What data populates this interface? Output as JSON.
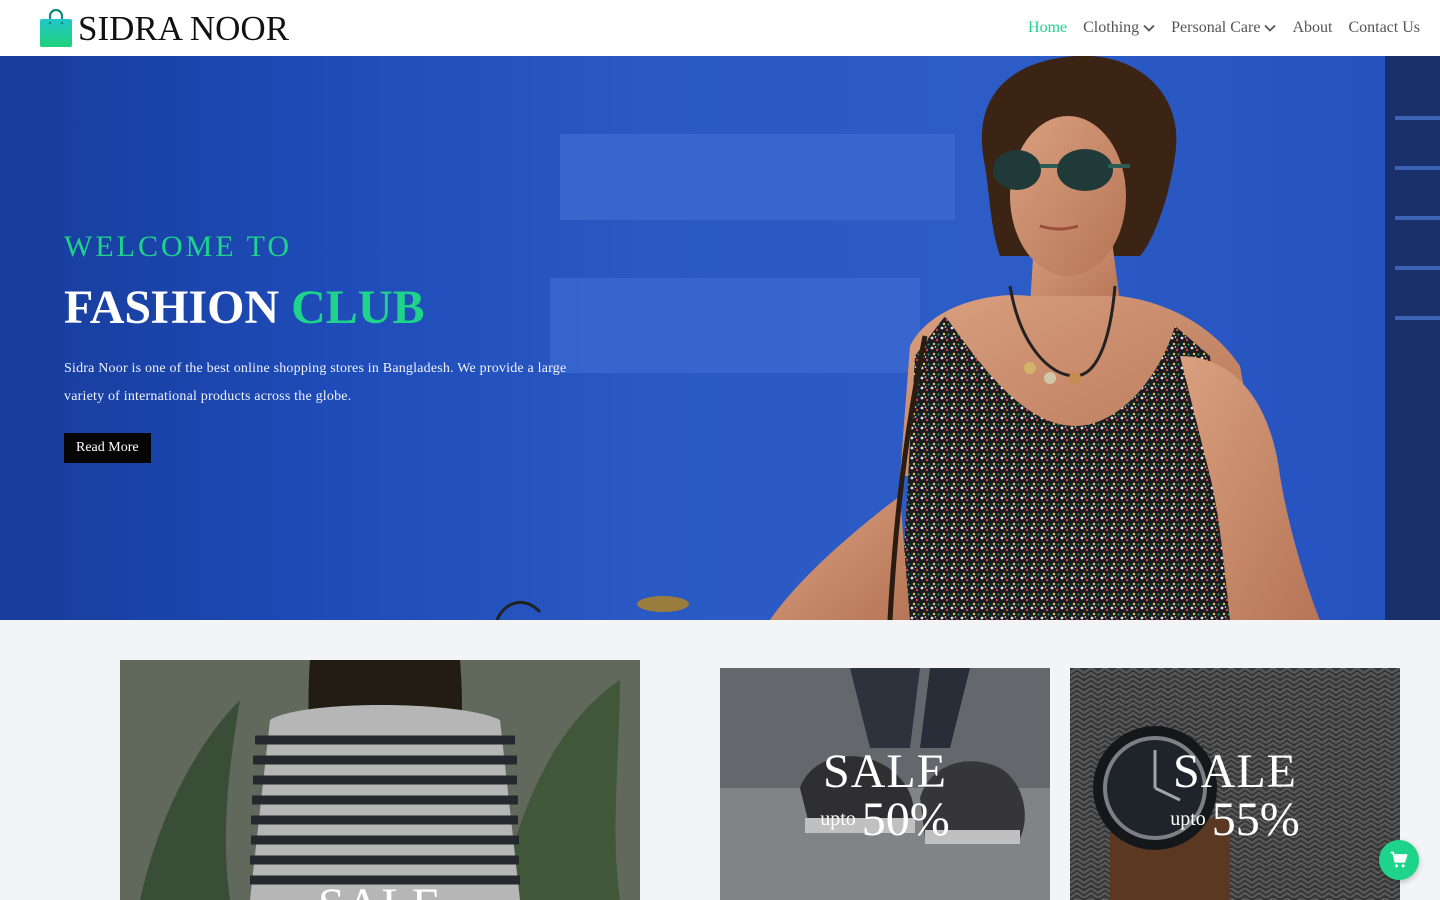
{
  "brand": {
    "name": "SIDRA NOOR",
    "logo_icon": "shopping-bag-icon"
  },
  "nav": {
    "home": "Home",
    "clothing": "Clothing",
    "personal_care": "Personal Care",
    "about": "About",
    "contact": "Contact Us"
  },
  "hero": {
    "eyebrow": "WELCOME TO",
    "title_main": "FASHION",
    "title_accent": "CLUB",
    "description": "Sidra Noor is one of the best online shopping stores in Bangladesh. We provide a large variety of international products across the globe.",
    "button": "Read More"
  },
  "promos": [
    {
      "sale": "SALE"
    },
    {
      "sale": "SALE",
      "upto": "upto",
      "percent": "50%"
    },
    {
      "sale": "SALE",
      "upto": "upto",
      "percent": "55%"
    }
  ],
  "cart_icon": "cart-icon",
  "colors": {
    "accent": "#1dd48a",
    "hero_blue": "#2a59c4",
    "button_bg": "#050505"
  }
}
